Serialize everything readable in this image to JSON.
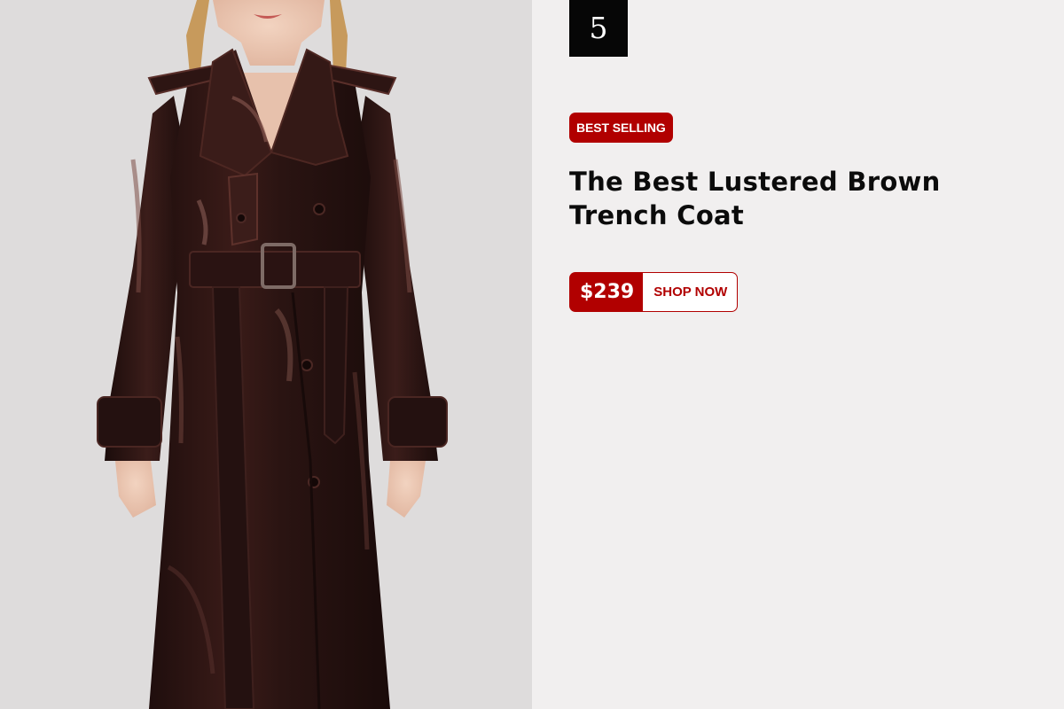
{
  "product": {
    "rank": "5",
    "badge": "BEST SELLING",
    "title_line1": "The Best Lustered Brown",
    "title_line2": "Trench Coat",
    "price": "$239",
    "cta": "SHOP NOW"
  },
  "colors": {
    "accent_red": "#b10000",
    "coat_brown": "#2a1412",
    "photo_background": "#dedcdc",
    "panel_background": "#f1efef"
  }
}
